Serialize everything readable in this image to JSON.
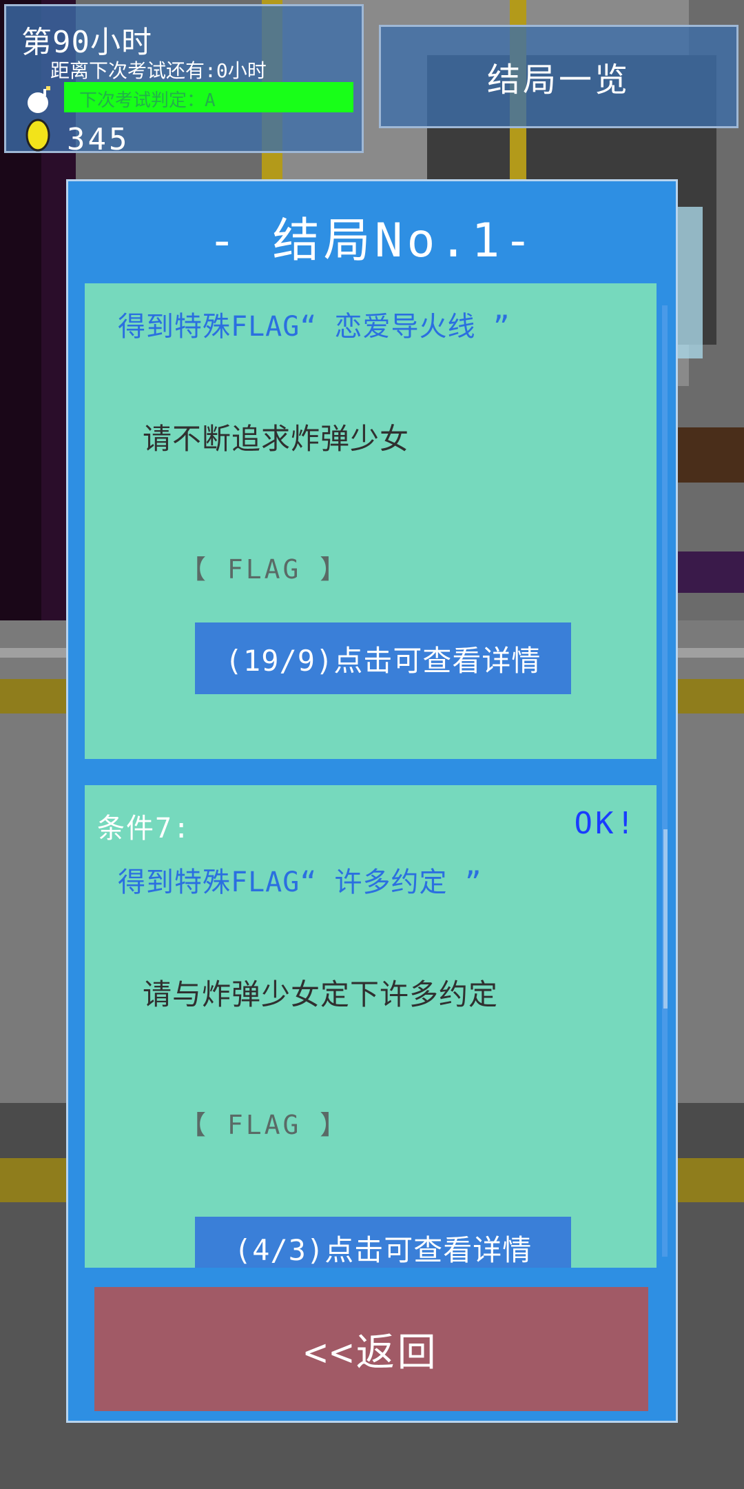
{
  "hud": {
    "day": "第90小时",
    "countdown": "距离下次考试还有:0小时",
    "exam_judgement": "下次考试判定：A",
    "coins": "345",
    "icons": [
      "bomb-icon",
      "coin-icon"
    ]
  },
  "overview_button": "结局一览",
  "panel": {
    "title": "- 结局No.1-",
    "conditions": [
      {
        "title": "得到特殊FLAG“ 恋爱导火线 ”",
        "description": "请不断追求炸弹少女",
        "tag": "【 FLAG 】",
        "detail_button": "(19/9)点击可查看详情"
      },
      {
        "label": "条件7:",
        "status": "OK!",
        "title": "得到特殊FLAG“ 许多约定 ”",
        "description": "请与炸弹少女定下许多约定",
        "tag": "【 FLAG 】",
        "detail_button": "(4/3)点击可查看详情"
      }
    ],
    "back_button": "<<返回"
  },
  "colors": {
    "panel": "#2e8fe3",
    "card": "#76d9bd",
    "back_button": "#a15a66",
    "exam_bar": "#18ff18",
    "ok_text": "#1a3cff"
  }
}
